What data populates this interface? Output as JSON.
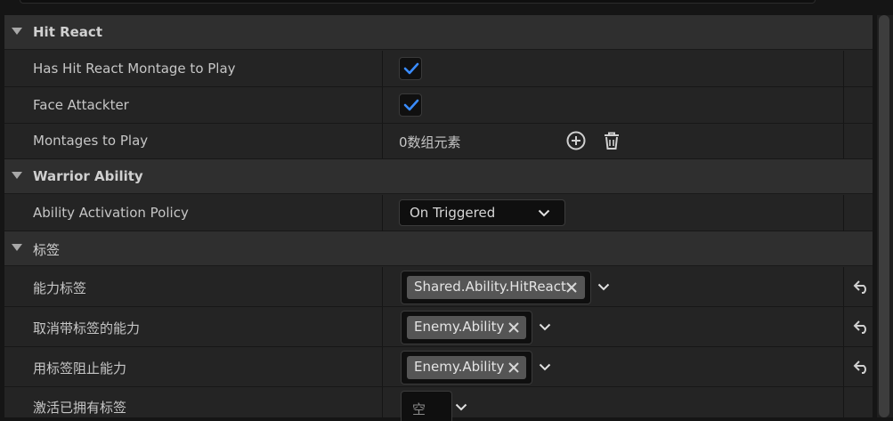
{
  "sections": {
    "hit_react": "Hit React",
    "warrior_ability": "Warrior Ability",
    "tags": "标签"
  },
  "hit_react": {
    "has_montage": {
      "label": "Has Hit React Montage to Play",
      "checked": true
    },
    "face_attacker": {
      "label": "Face Attackter",
      "checked": true
    },
    "montages": {
      "label": "Montages to Play",
      "value": "0数组元素"
    }
  },
  "warrior_ability": {
    "activation_policy": {
      "label": "Ability Activation Policy",
      "value": "On Triggered"
    }
  },
  "tags": {
    "ability_tags": {
      "label": "能力标签",
      "tag": "Shared.Ability.HitReact"
    },
    "cancel_abilities_with_tag": {
      "label": "取消带标签的能力",
      "tag": "Enemy.Ability"
    },
    "block_abilities_with_tag": {
      "label": "用标签阻止能力",
      "tag": "Enemy.Ability"
    },
    "activation_owned_tags": {
      "label": "激活已拥有标签",
      "value": "空"
    }
  },
  "colors": {
    "accent": "#2f7de1",
    "check": "#3a8cff"
  },
  "icons": [
    "collapse-arrow-icon",
    "checkmark-icon",
    "add-circle-icon",
    "trash-icon",
    "chevron-down-icon",
    "close-icon",
    "reset-arrow-icon"
  ]
}
